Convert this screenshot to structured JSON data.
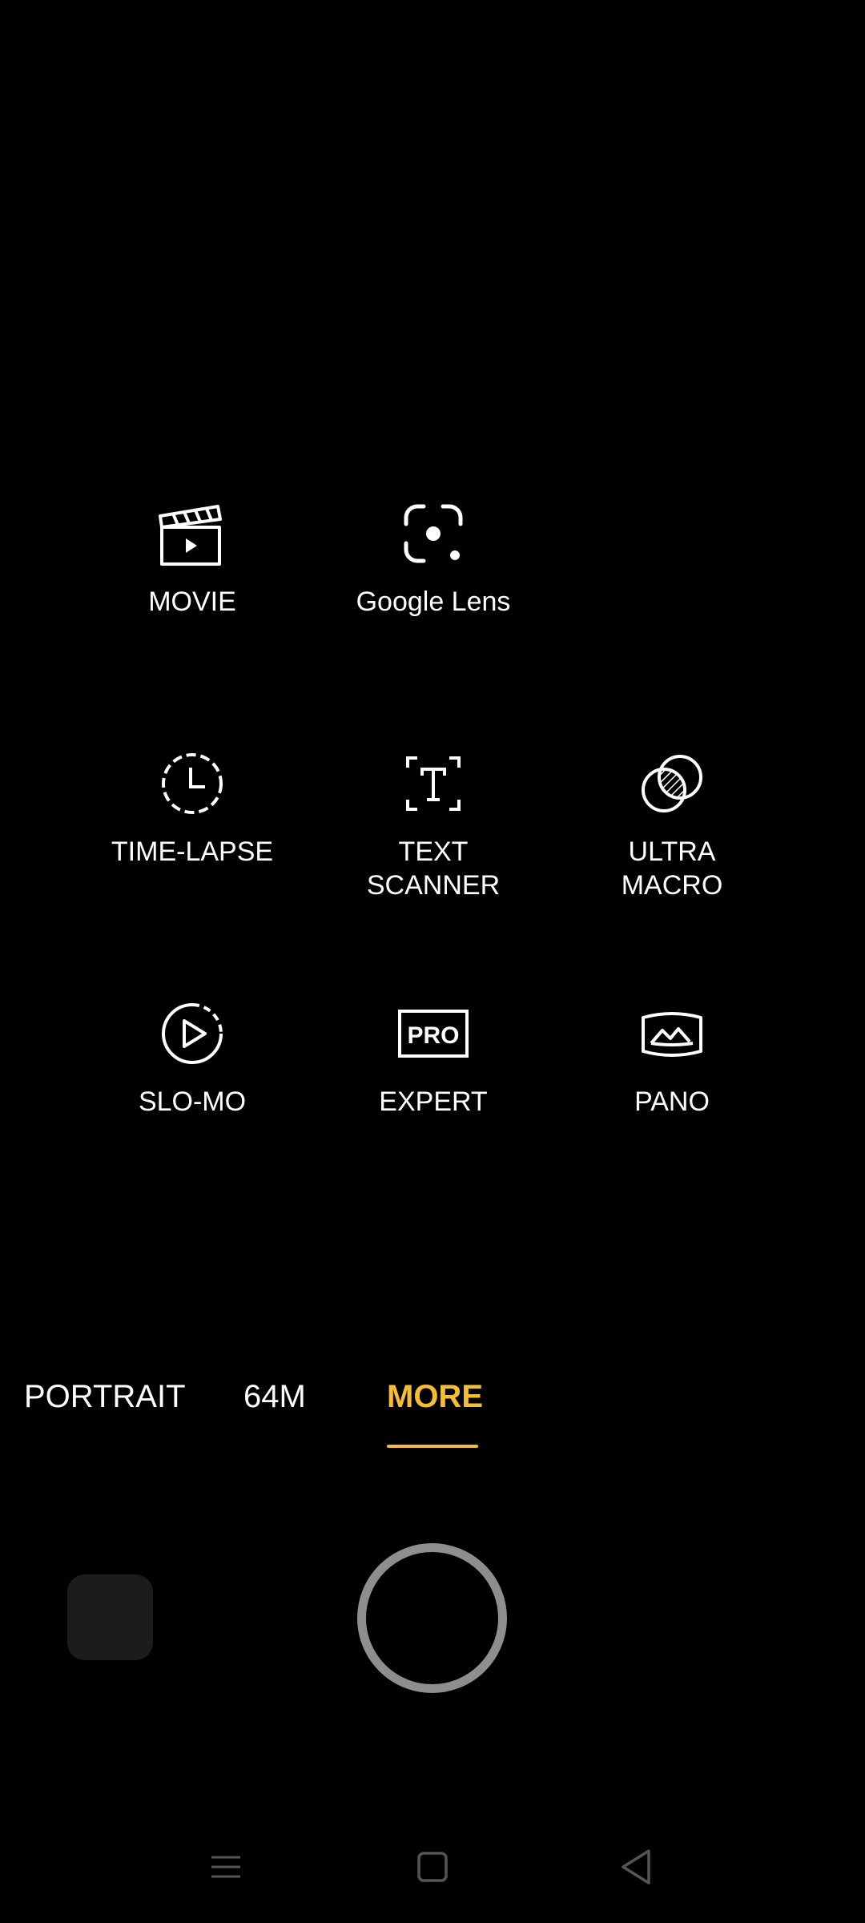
{
  "modes": [
    {
      "id": "movie",
      "label": "MOVIE",
      "icon": "clapperboard-icon"
    },
    {
      "id": "google-lens",
      "label": "Google Lens",
      "icon": "google-lens-icon"
    },
    {
      "id": "time-lapse",
      "label": "TIME-LAPSE",
      "icon": "dashed-clock-icon"
    },
    {
      "id": "text-scanner",
      "label": "TEXT\nSCANNER",
      "icon": "text-scan-icon"
    },
    {
      "id": "ultra-macro",
      "label": "ULTRA\nMACRO",
      "icon": "overlapping-circles-icon"
    },
    {
      "id": "slo-mo",
      "label": "SLO-MO",
      "icon": "dashed-play-icon"
    },
    {
      "id": "expert",
      "label": "EXPERT",
      "icon": "pro-badge-icon"
    },
    {
      "id": "pano",
      "label": "PANO",
      "icon": "panorama-icon"
    }
  ],
  "mode_tabs": [
    {
      "label": "PORTRAIT",
      "active": false
    },
    {
      "label": "64M",
      "active": false
    },
    {
      "label": "MORE",
      "active": true
    }
  ],
  "colors": {
    "accent": "#f5bd34",
    "shutter_ring": "#8e8e8e",
    "thumbnail_bg": "#1c1c1c",
    "nav_icons": "#555555"
  },
  "nav_bar": {
    "buttons": [
      "menu-icon",
      "home-square-icon",
      "back-triangle-icon"
    ]
  }
}
